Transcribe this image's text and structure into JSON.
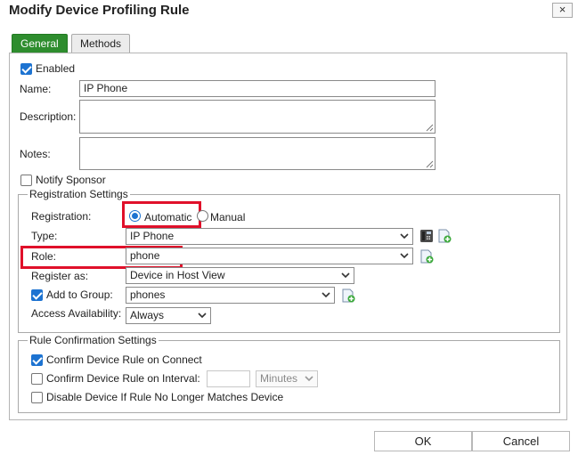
{
  "dialog": {
    "title": "Modify Device Profiling Rule",
    "close_label": "×"
  },
  "tabs": [
    {
      "label": "General"
    },
    {
      "label": "Methods"
    }
  ],
  "general": {
    "enabled_label": "Enabled",
    "name_label": "Name:",
    "name_value": "IP Phone",
    "description_label": "Description:",
    "notes_label": "Notes:",
    "notify_sponsor_label": "Notify Sponsor"
  },
  "registration_settings": {
    "legend": "Registration Settings",
    "registration_label": "Registration:",
    "automatic_label": "Automatic",
    "manual_label": "Manual",
    "type_label": "Type:",
    "type_value": "IP Phone",
    "role_label": "Role:",
    "role_value": "phone",
    "register_as_label": "Register as:",
    "register_as_value": "Device in Host View",
    "add_to_group_label": "Add to Group:",
    "add_to_group_value": "phones",
    "access_availability_label": "Access Availability:",
    "access_availability_value": "Always"
  },
  "rule_confirmation": {
    "legend": "Rule Confirmation Settings",
    "confirm_on_connect_label": "Confirm Device Rule on Connect",
    "confirm_on_interval_label": "Confirm Device Rule on Interval:",
    "interval_value": "",
    "interval_unit": "Minutes",
    "disable_label": "Disable Device If Rule No Longer Matches Device"
  },
  "footer": {
    "ok_label": "OK",
    "cancel_label": "Cancel"
  },
  "colors": {
    "accent_green": "#2e8d2e",
    "highlight_red": "#e0102a",
    "checkbox_blue": "#1d73d1"
  }
}
